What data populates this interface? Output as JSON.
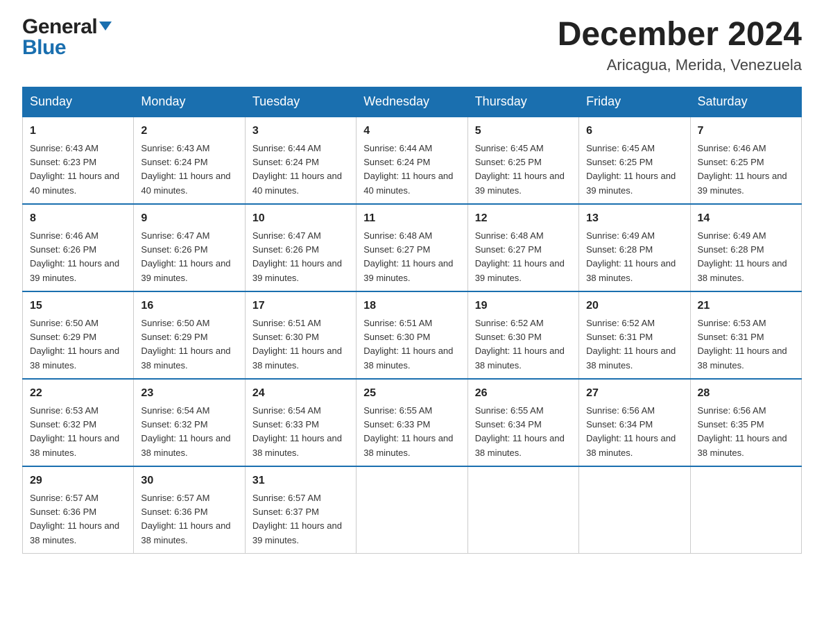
{
  "logo": {
    "general": "General",
    "blue": "Blue",
    "triangle": "▶"
  },
  "title": "December 2024",
  "subtitle": "Aricagua, Merida, Venezuela",
  "days_of_week": [
    "Sunday",
    "Monday",
    "Tuesday",
    "Wednesday",
    "Thursday",
    "Friday",
    "Saturday"
  ],
  "weeks": [
    [
      {
        "day": "1",
        "sunrise": "6:43 AM",
        "sunset": "6:23 PM",
        "daylight": "11 hours and 40 minutes."
      },
      {
        "day": "2",
        "sunrise": "6:43 AM",
        "sunset": "6:24 PM",
        "daylight": "11 hours and 40 minutes."
      },
      {
        "day": "3",
        "sunrise": "6:44 AM",
        "sunset": "6:24 PM",
        "daylight": "11 hours and 40 minutes."
      },
      {
        "day": "4",
        "sunrise": "6:44 AM",
        "sunset": "6:24 PM",
        "daylight": "11 hours and 40 minutes."
      },
      {
        "day": "5",
        "sunrise": "6:45 AM",
        "sunset": "6:25 PM",
        "daylight": "11 hours and 39 minutes."
      },
      {
        "day": "6",
        "sunrise": "6:45 AM",
        "sunset": "6:25 PM",
        "daylight": "11 hours and 39 minutes."
      },
      {
        "day": "7",
        "sunrise": "6:46 AM",
        "sunset": "6:25 PM",
        "daylight": "11 hours and 39 minutes."
      }
    ],
    [
      {
        "day": "8",
        "sunrise": "6:46 AM",
        "sunset": "6:26 PM",
        "daylight": "11 hours and 39 minutes."
      },
      {
        "day": "9",
        "sunrise": "6:47 AM",
        "sunset": "6:26 PM",
        "daylight": "11 hours and 39 minutes."
      },
      {
        "day": "10",
        "sunrise": "6:47 AM",
        "sunset": "6:26 PM",
        "daylight": "11 hours and 39 minutes."
      },
      {
        "day": "11",
        "sunrise": "6:48 AM",
        "sunset": "6:27 PM",
        "daylight": "11 hours and 39 minutes."
      },
      {
        "day": "12",
        "sunrise": "6:48 AM",
        "sunset": "6:27 PM",
        "daylight": "11 hours and 39 minutes."
      },
      {
        "day": "13",
        "sunrise": "6:49 AM",
        "sunset": "6:28 PM",
        "daylight": "11 hours and 38 minutes."
      },
      {
        "day": "14",
        "sunrise": "6:49 AM",
        "sunset": "6:28 PM",
        "daylight": "11 hours and 38 minutes."
      }
    ],
    [
      {
        "day": "15",
        "sunrise": "6:50 AM",
        "sunset": "6:29 PM",
        "daylight": "11 hours and 38 minutes."
      },
      {
        "day": "16",
        "sunrise": "6:50 AM",
        "sunset": "6:29 PM",
        "daylight": "11 hours and 38 minutes."
      },
      {
        "day": "17",
        "sunrise": "6:51 AM",
        "sunset": "6:30 PM",
        "daylight": "11 hours and 38 minutes."
      },
      {
        "day": "18",
        "sunrise": "6:51 AM",
        "sunset": "6:30 PM",
        "daylight": "11 hours and 38 minutes."
      },
      {
        "day": "19",
        "sunrise": "6:52 AM",
        "sunset": "6:30 PM",
        "daylight": "11 hours and 38 minutes."
      },
      {
        "day": "20",
        "sunrise": "6:52 AM",
        "sunset": "6:31 PM",
        "daylight": "11 hours and 38 minutes."
      },
      {
        "day": "21",
        "sunrise": "6:53 AM",
        "sunset": "6:31 PM",
        "daylight": "11 hours and 38 minutes."
      }
    ],
    [
      {
        "day": "22",
        "sunrise": "6:53 AM",
        "sunset": "6:32 PM",
        "daylight": "11 hours and 38 minutes."
      },
      {
        "day": "23",
        "sunrise": "6:54 AM",
        "sunset": "6:32 PM",
        "daylight": "11 hours and 38 minutes."
      },
      {
        "day": "24",
        "sunrise": "6:54 AM",
        "sunset": "6:33 PM",
        "daylight": "11 hours and 38 minutes."
      },
      {
        "day": "25",
        "sunrise": "6:55 AM",
        "sunset": "6:33 PM",
        "daylight": "11 hours and 38 minutes."
      },
      {
        "day": "26",
        "sunrise": "6:55 AM",
        "sunset": "6:34 PM",
        "daylight": "11 hours and 38 minutes."
      },
      {
        "day": "27",
        "sunrise": "6:56 AM",
        "sunset": "6:34 PM",
        "daylight": "11 hours and 38 minutes."
      },
      {
        "day": "28",
        "sunrise": "6:56 AM",
        "sunset": "6:35 PM",
        "daylight": "11 hours and 38 minutes."
      }
    ],
    [
      {
        "day": "29",
        "sunrise": "6:57 AM",
        "sunset": "6:36 PM",
        "daylight": "11 hours and 38 minutes."
      },
      {
        "day": "30",
        "sunrise": "6:57 AM",
        "sunset": "6:36 PM",
        "daylight": "11 hours and 38 minutes."
      },
      {
        "day": "31",
        "sunrise": "6:57 AM",
        "sunset": "6:37 PM",
        "daylight": "11 hours and 39 minutes."
      },
      null,
      null,
      null,
      null
    ]
  ],
  "labels": {
    "sunrise": "Sunrise:",
    "sunset": "Sunset:",
    "daylight": "Daylight:"
  }
}
